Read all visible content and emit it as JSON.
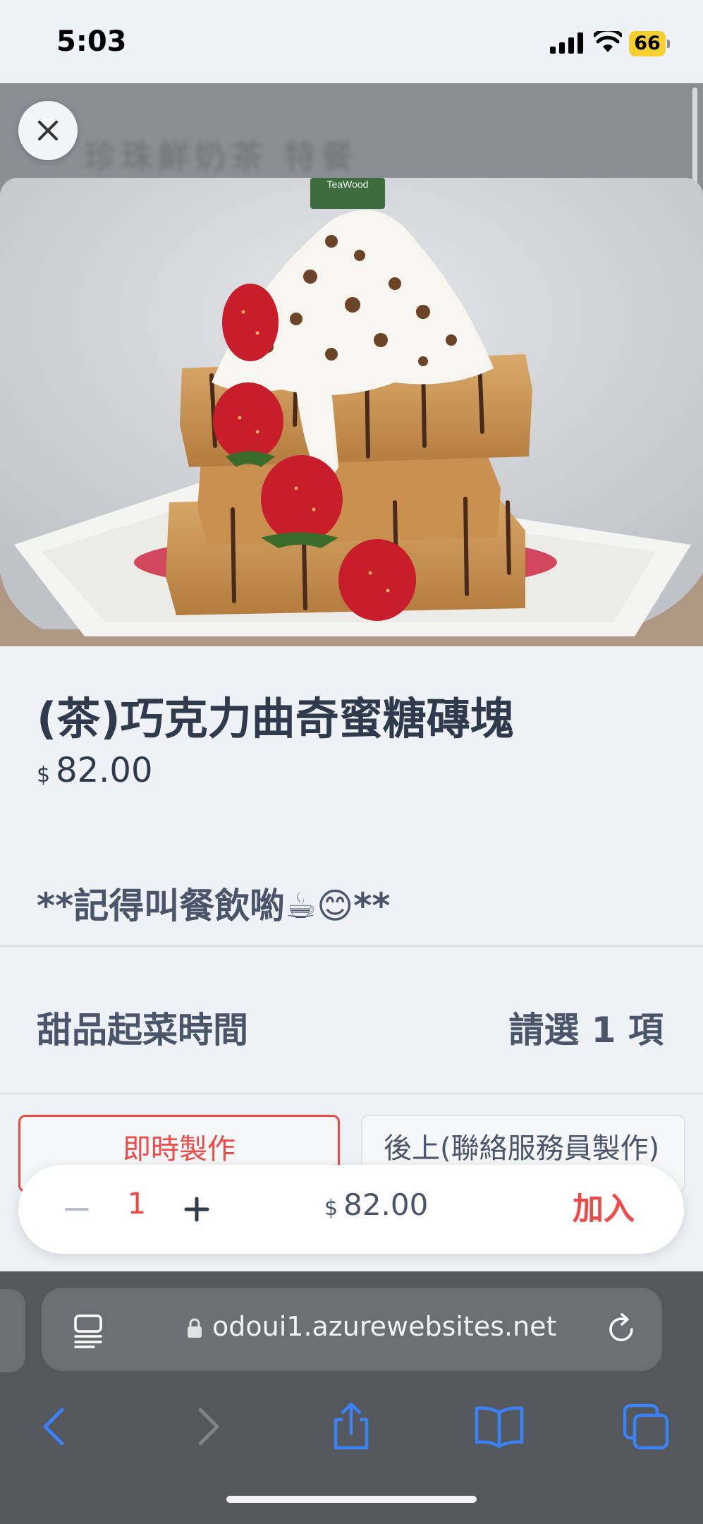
{
  "status_bar": {
    "time": "5:03",
    "battery_level": "66",
    "icons": [
      "signal-icon",
      "wifi-icon",
      "battery-icon"
    ]
  },
  "backdrop": {
    "blurred_text": "珍珠鮮奶茶 特餐"
  },
  "product": {
    "name": "(茶)巧克力曲奇蜜糖磚塊",
    "currency": "$",
    "price": "82.00",
    "note": "**記得叫餐飲喲☕😊**",
    "image_icon": "honey-toast-photo",
    "image_label": "TeaWood"
  },
  "option_group": {
    "title": "甜品起菜時間",
    "hint": "請選 1 項",
    "options": [
      {
        "label": "即時製作",
        "selected": true
      },
      {
        "label": "後上(聯絡服務員製作)",
        "selected": false
      }
    ]
  },
  "cart_bar": {
    "quantity": "1",
    "currency": "$",
    "total": "82.00",
    "add_label": "加入"
  },
  "browser": {
    "url": "odoui1.azurewebsites.net",
    "toolbar_icons": [
      "back-icon",
      "forward-icon",
      "share-icon",
      "bookmarks-icon",
      "tabs-icon"
    ]
  },
  "colors": {
    "accent": "#ee4a48",
    "text": "#2f3a4c",
    "background": "#eef1f5",
    "browser_chrome": "#54575c",
    "ios_blue": "#3a82f7"
  }
}
